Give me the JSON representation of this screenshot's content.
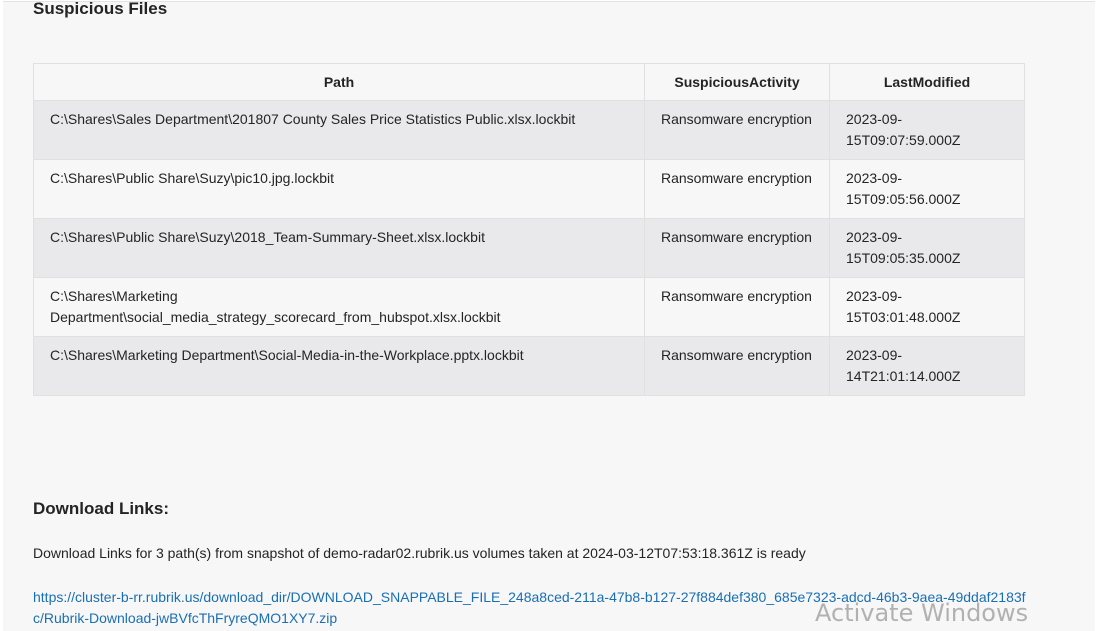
{
  "suspicious_files": {
    "title": "Suspicious Files",
    "headers": {
      "path": "Path",
      "activity": "SuspiciousActivity",
      "modified": "LastModified"
    },
    "rows": [
      {
        "path": "C:\\Shares\\Sales Department\\201807 County Sales Price Statistics Public.xlsx.lockbit",
        "activity": "Ransomware encryption",
        "modified": "2023-09-15T09:07:59.000Z"
      },
      {
        "path": "C:\\Shares\\Public Share\\Suzy\\pic10.jpg.lockbit",
        "activity": "Ransomware encryption",
        "modified": "2023-09-15T09:05:56.000Z"
      },
      {
        "path": "C:\\Shares\\Public Share\\Suzy\\2018_Team-Summary-Sheet.xlsx.lockbit",
        "activity": "Ransomware encryption",
        "modified": "2023-09-15T09:05:35.000Z"
      },
      {
        "path": "C:\\Shares\\Marketing Department\\social_media_strategy_scorecard_from_hubspot.xlsx.lockbit",
        "activity": "Ransomware encryption",
        "modified": "2023-09-15T03:01:48.000Z"
      },
      {
        "path": "C:\\Shares\\Marketing Department\\Social-Media-in-the-Workplace.pptx.lockbit",
        "activity": "Ransomware encryption",
        "modified": "2023-09-14T21:01:14.000Z"
      }
    ]
  },
  "download_links": {
    "title": "Download Links:",
    "description": "Download Links for 3 path(s) from snapshot of demo-radar02.rubrik.us volumes taken at 2024-03-12T07:53:18.361Z is ready",
    "url": "https://cluster-b-rr.rubrik.us/download_dir/DOWNLOAD_SNAPPABLE_FILE_248a8ced-211a-47b8-b127-27f884def380_685e7323-adcd-46b3-9aea-49ddaf2183fc/Rubrik-Download-jwBVfcThFryreQMO1XY7.zip"
  },
  "watermark": "Activate Windows",
  "colors": {
    "link": "#1a6fb3",
    "row_stripe": "#e9e9eb",
    "background": "#f7f7f8"
  }
}
